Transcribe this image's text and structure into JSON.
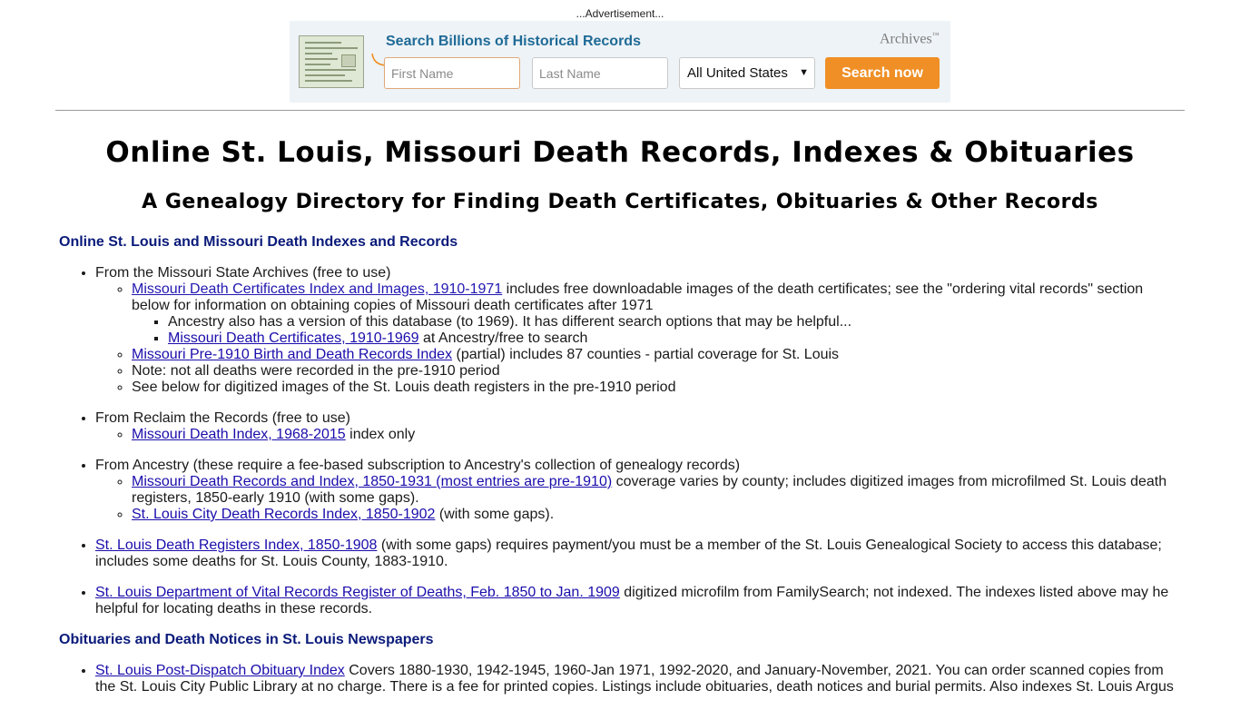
{
  "ad": {
    "label": "...Advertisement...",
    "title": "Search Billions of Historical Records",
    "brand": "Archives",
    "brand_mark": "™",
    "first_name_placeholder": "First Name",
    "last_name_placeholder": "Last Name",
    "location_selected": "All United States",
    "search_button": "Search now",
    "colors": {
      "title": "#1f6a96",
      "button": "#ef8f25",
      "background": "#eef3f7"
    }
  },
  "page": {
    "title": "Online St. Louis, Missouri Death Records, Indexes & Obituaries",
    "subtitle": "A Genealogy Directory for Finding Death Certificates, Obituaries & Other Records"
  },
  "section1": {
    "heading": "Online St. Louis and Missouri Death Indexes and Records",
    "items": [
      {
        "text": "From the Missouri State Archives (free to use)",
        "sub": [
          {
            "link": "Missouri Death Certificates Index and Images, 1910-1971",
            "text": " includes free downloadable images of the death certificates; see the \"ordering vital records\" section below for information on obtaining copies of Missouri death certificates after 1971",
            "sub": [
              {
                "text": "Ancestry also has a version of this database (to 1969). It has different search options that may be helpful..."
              },
              {
                "link": "Missouri Death Certificates, 1910-1969",
                "text": " at Ancestry/free to search"
              }
            ]
          },
          {
            "link": "Missouri Pre-1910 Birth and Death Records Index",
            "text": " (partial) includes 87 counties - partial coverage for St. Louis"
          },
          {
            "text": "Note: not all deaths were recorded in the pre-1910 period"
          },
          {
            "text": "See below for digitized images of the St. Louis death registers in the pre-1910 period"
          }
        ]
      },
      {
        "text": "From Reclaim the Records (free to use)",
        "sub": [
          {
            "link": "Missouri Death Index, 1968-2015",
            "text": " index only"
          }
        ]
      },
      {
        "text": "From Ancestry (these require a fee-based subscription to Ancestry's collection of genealogy records)",
        "sub": [
          {
            "link": "Missouri Death Records and Index, 1850-1931 (most entries are pre-1910)",
            "text": " coverage varies by county; includes digitized images from microfilmed St. Louis death registers, 1850-early 1910 (with some gaps)."
          },
          {
            "link": "St. Louis City Death Records Index, 1850-1902",
            "text": " (with some gaps)."
          }
        ]
      },
      {
        "link": "St. Louis Death Registers Index, 1850-1908",
        "text": " (with some gaps) requires payment/you must be a member of the St. Louis Genealogical Society to access this database; includes some deaths for St. Louis County, 1883-1910."
      },
      {
        "link": "St. Louis Department of Vital Records Register of Deaths, Feb. 1850 to Jan. 1909",
        "text": " digitized microfilm from FamilySearch; not indexed. The indexes listed above may he helpful for locating deaths in these records."
      }
    ]
  },
  "section2": {
    "heading": "Obituaries and Death Notices in St. Louis Newspapers",
    "items": [
      {
        "link": "St. Louis Post-Dispatch Obituary Index",
        "text": " Covers 1880-1930, 1942-1945, 1960-Jan 1971, 1992-2020, and January-November, 2021. You can order scanned copies from the St. Louis City Public Library at no charge. There is a fee for printed copies. Listings include obituaries, death notices and burial permits. Also indexes St. Louis Argus"
      }
    ]
  }
}
